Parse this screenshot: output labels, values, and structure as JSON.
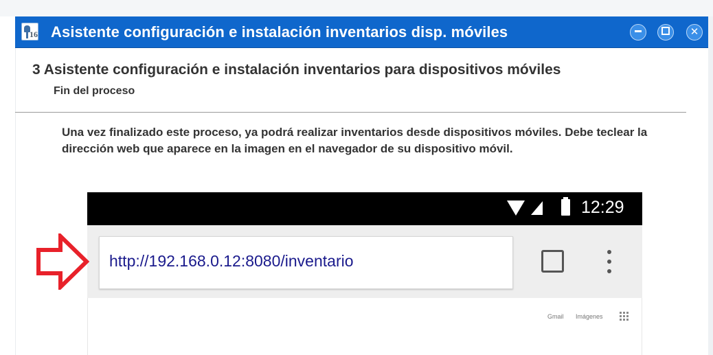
{
  "window": {
    "title": "Asistente configuración e instalación inventarios disp. móviles",
    "icon_name": "app-icon",
    "buttons": [
      "minimize-button",
      "maximize-button",
      "close-button"
    ]
  },
  "header": {
    "step_title": "3 Asistente configuración e instalación inventarios para dispositivos móviles",
    "subtitle": "Fin del proceso"
  },
  "description": "Una vez finalizado este proceso, ya podrá realizar inventarios desde dispositivos móviles. Debe teclear la dirección web que aparece en la imagen en el navegador de su dispositivo móvil.",
  "phone": {
    "status_time": "12:29",
    "status_icons": [
      "wifi-icon",
      "signal-icon",
      "battery-icon"
    ],
    "url": "http://192.168.0.12:8080/inventario",
    "toolbar_icons": [
      "tabs-icon",
      "overflow-menu-icon"
    ],
    "page_links": [
      "Gmail",
      "Imágenes"
    ],
    "page_icons": [
      "apps-grid-icon"
    ]
  },
  "annotation": {
    "icon_name": "arrow-right-icon",
    "color": "#e8212a"
  },
  "colors": {
    "titlebar": "#0f67cc",
    "url_text": "#1a1a8c",
    "body_text": "#333333"
  }
}
